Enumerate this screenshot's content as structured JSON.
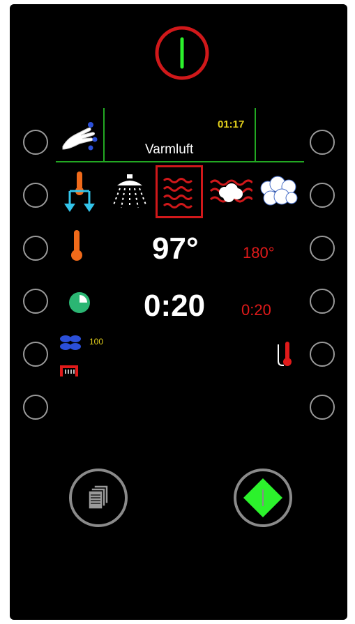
{
  "program": {
    "name": "Varmluft",
    "clock": "01:17"
  },
  "modes": [
    {
      "name": "cool-down",
      "icon": "thermometer-arrows-down-icon"
    },
    {
      "name": "steam-shower",
      "icon": "shower-icon"
    },
    {
      "name": "hot-air",
      "icon": "hot-air-waves-icon",
      "selected": true
    },
    {
      "name": "combi",
      "icon": "combi-steam-waves-icon"
    },
    {
      "name": "steam",
      "icon": "steam-cloud-icon"
    }
  ],
  "temperature": {
    "actual": "97°",
    "set": "180°"
  },
  "time": {
    "actual": "0:20",
    "set": "0:20"
  },
  "fan": {
    "speed": "100"
  },
  "colors": {
    "accent_green": "#22a822",
    "set_value_red": "#e01a1a",
    "clock_yellow": "#e6d21c",
    "power_red": "#d0181a",
    "start_green": "#2cf22c"
  }
}
